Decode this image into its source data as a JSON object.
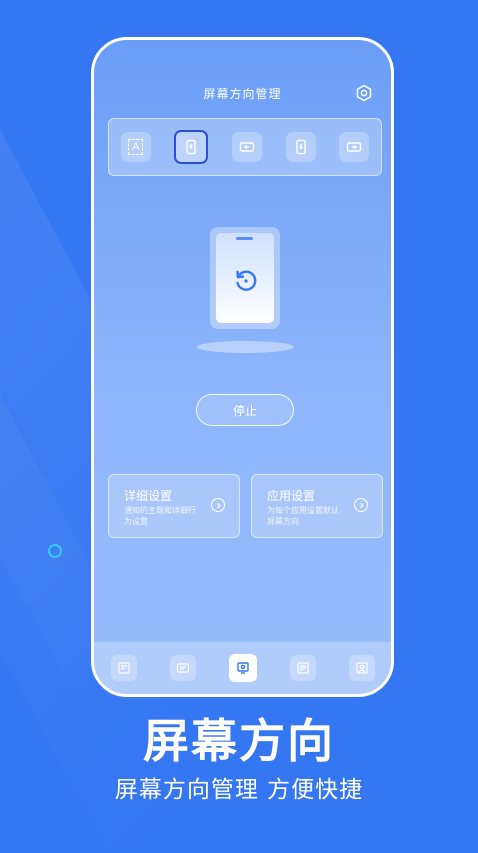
{
  "app": {
    "title": "屏幕方向管理"
  },
  "modes": [
    {
      "name": "auto",
      "letter": "A",
      "active": false
    },
    {
      "name": "portrait",
      "active": true
    },
    {
      "name": "landscape",
      "active": false
    },
    {
      "name": "portrait-reverse",
      "active": false
    },
    {
      "name": "landscape-reverse",
      "active": false
    }
  ],
  "stop_label": "停止",
  "cards": [
    {
      "title": "详细设置",
      "desc": "通知的主题和详细行为设置"
    },
    {
      "title": "应用设置",
      "desc": "为每个应用设置默认屏幕方向"
    }
  ],
  "bottom_nav": [
    "tab-1",
    "tab-2",
    "tab-3",
    "tab-4",
    "tab-5"
  ],
  "promo": {
    "headline": "屏幕方向",
    "subline": "屏幕方向管理 方便快捷"
  },
  "colors": {
    "background": "#3576f3",
    "accent": "#2d4fd6",
    "ring": "#38c6ff"
  }
}
